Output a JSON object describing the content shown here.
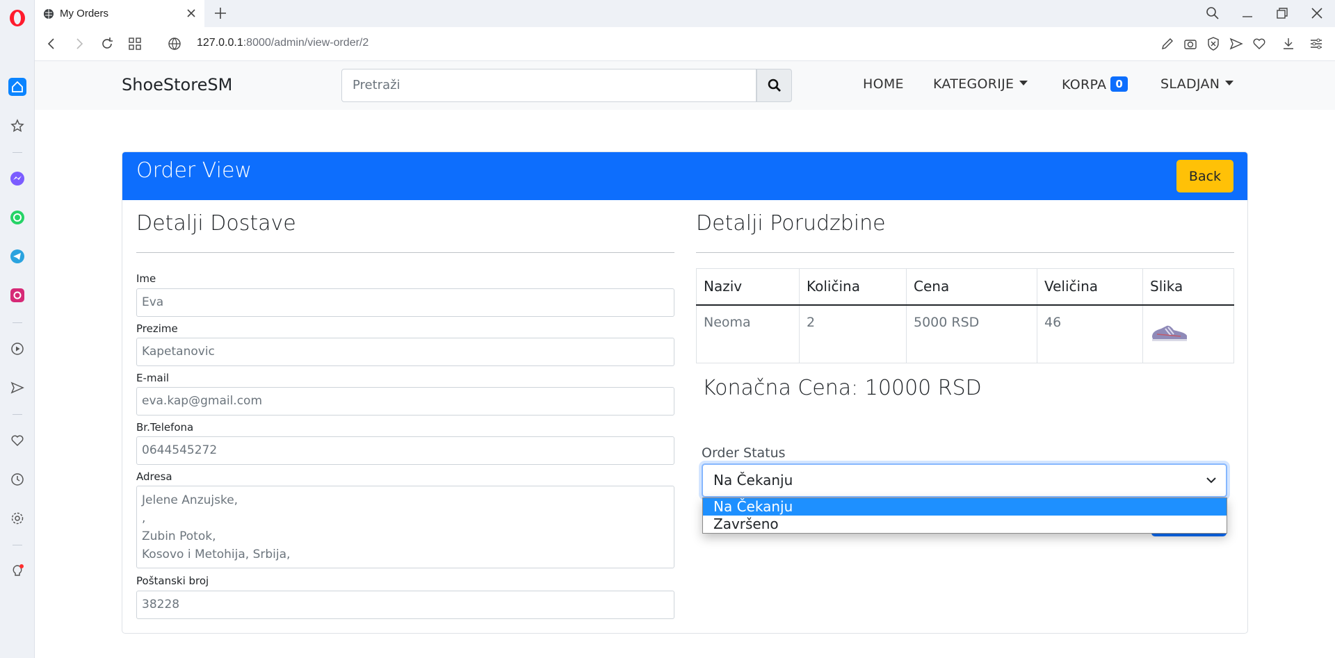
{
  "browser": {
    "tab_title": "My Orders",
    "url_host": "127.0.0.1",
    "url_path": ":8000/admin/view-order/2"
  },
  "navbar": {
    "brand": "ShoeStoreSM",
    "search_placeholder": "Pretraži",
    "links": {
      "home": "HOME",
      "categories": "KATEGORIJE",
      "cart": "KORPA",
      "cart_count": "0",
      "user": "SLADJAN"
    }
  },
  "card": {
    "title": "Order View",
    "back_label": "Back"
  },
  "delivery": {
    "title": "Detalji Dostave",
    "fields": {
      "first_name_label": "Ime",
      "first_name": "Eva",
      "last_name_label": "Prezime",
      "last_name": "Kapetanovic",
      "email_label": "E-mail",
      "email": "eva.kap@gmail.com",
      "phone_label": "Br.Telefona",
      "phone": "0644545272",
      "address_label": "Adresa",
      "address_lines": [
        "Jelene Anzujske,",
        ",",
        "Zubin Potok,",
        "Kosovo i Metohija, Srbija,"
      ],
      "postal_label": "Poštanski broj",
      "postal": "38228"
    }
  },
  "order": {
    "title": "Detalji Porudzbine",
    "columns": [
      "Naziv",
      "Količina",
      "Cena",
      "Veličina",
      "Slika"
    ],
    "rows": [
      {
        "name": "Neoma",
        "quantity": "2",
        "price": "5000 RSD",
        "size": "46",
        "image": "shoe-image"
      }
    ],
    "total": "Konačna Cena: 10000 RSD",
    "status_label": "Order Status",
    "status_value": "Na Čekanju",
    "status_options": [
      "Na Čekanju",
      "Završeno"
    ]
  }
}
